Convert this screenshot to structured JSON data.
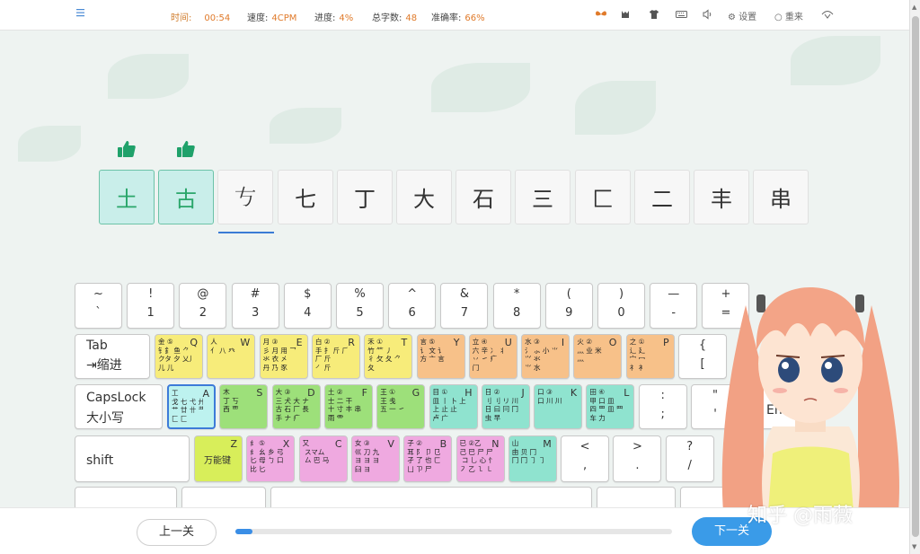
{
  "topbar": {
    "menu_icon": "hamburger-menu-icon",
    "stats": [
      {
        "label": "时间:",
        "value": "00:54"
      },
      {
        "label": "速度:",
        "value": "4CPM"
      },
      {
        "label": "进度:",
        "value": "4%"
      },
      {
        "label": "总字数:",
        "value": "48"
      },
      {
        "label": "准确率:",
        "value": "66%"
      }
    ],
    "settings_label": "设置",
    "restart_label": "重来"
  },
  "characters": [
    "土",
    "古",
    "𠀁",
    "七",
    "丁",
    "大",
    "石",
    "三",
    "匚",
    "二",
    "丰",
    "串"
  ],
  "completed_count": 2,
  "keyboard": {
    "number_row": [
      {
        "top": "~",
        "bottom": "`"
      },
      {
        "top": "!",
        "bottom": "1"
      },
      {
        "top": "@",
        "bottom": "2"
      },
      {
        "top": "#",
        "bottom": "3"
      },
      {
        "top": "$",
        "bottom": "4"
      },
      {
        "top": "%",
        "bottom": "5"
      },
      {
        "top": "^",
        "bottom": "6"
      },
      {
        "top": "&",
        "bottom": "7"
      },
      {
        "top": "*",
        "bottom": "8"
      },
      {
        "top": "(",
        "bottom": "9"
      },
      {
        "top": ")",
        "bottom": "0"
      },
      {
        "top": "—",
        "bottom": "-"
      },
      {
        "top": "+",
        "bottom": "="
      }
    ],
    "tab": {
      "line1": "Tab",
      "line2": "⇥缩进"
    },
    "capslock": {
      "line1": "CapsLock",
      "line2": "大小写"
    },
    "shift": "shift",
    "q_row": [
      {
        "letter": "Q",
        "roots": "金 ⑤\n钅釒 鱼 ⺈\nクタ 夕 乂儿\n儿 儿",
        "color": "yellow"
      },
      {
        "letter": "W",
        "roots": "人\n亻 八 癶\n",
        "color": "yellow"
      },
      {
        "letter": "E",
        "roots": "月 ③\n彡 月 用 乛 豕\n氺 衣 㐅\n丹 乃 豕",
        "color": "yellow"
      },
      {
        "letter": "R",
        "roots": "白 ②\n手 扌 斤 ⺁\n厂 斤\n㇒ 斤",
        "color": "yellow"
      },
      {
        "letter": "T",
        "roots": "禾 ①\n竹 ⺮ 丿\n彳 攵 夂 ⺈\n夂",
        "color": "yellow"
      },
      {
        "letter": "Y",
        "roots": "言 ⑤\n讠 文 讠\n方 亠 言",
        "color": "orange"
      },
      {
        "letter": "U",
        "roots": "立 ④\n六 辛 冫 丬\n丷 ㇀ 疒\n门",
        "color": "orange"
      },
      {
        "letter": "I",
        "roots": "水 ③\n氵 ⺗ 小 ⺌\n⺍ 氺\n⺌ 水",
        "color": "orange"
      },
      {
        "letter": "O",
        "roots": "火 ②\n⺣ 业 米\n灬",
        "color": "orange"
      },
      {
        "letter": "P",
        "roots": "之 ①\n辶 廴\n宀 冖\n礻 衤",
        "color": "orange"
      },
      {
        "top": "{",
        "bottom": "["
      }
    ],
    "a_row": [
      {
        "letter": "A",
        "roots": "工\n戈 七 弋 廾\n艹 廿 卄 龷\n匚 匚",
        "color": "active"
      },
      {
        "letter": "S",
        "roots": "木\n丁 丂\n西 覀\n",
        "color": "green"
      },
      {
        "letter": "D",
        "roots": "大 ③\n三 犬 大 ナ 尢\n古 石 厂 長\n手 ナ 疒",
        "color": "green"
      },
      {
        "letter": "F",
        "roots": "土 ②\n士 二 干\n十 寸 丰 串\n雨 ⻗",
        "color": "green"
      },
      {
        "letter": "G",
        "roots": "王 ①\n王 戋\n五 一 ㇀",
        "color": "green"
      },
      {
        "letter": "H",
        "roots": "目 ①\n皿 丨 卜 上\n上 止 止\n卢 广",
        "color": "cyan"
      },
      {
        "letter": "J",
        "roots": "日 ②\n刂 刂 リ 川\n日 曰 冃 冂\n虫 早",
        "color": "cyan"
      },
      {
        "letter": "K",
        "roots": "口 ③\n口 川 川\n",
        "color": "cyan"
      },
      {
        "letter": "L",
        "roots": "田 ④\n甲 口 皿\n四 罒 皿 ⺲\n车 力",
        "color": "cyan"
      },
      {
        "top": ":",
        "bottom": ";"
      },
      {
        "top": "\"",
        "bottom": "'"
      }
    ],
    "z_row": [
      {
        "letter": "Z",
        "label": "万能键",
        "color": "lime"
      },
      {
        "letter": "X",
        "roots": "纟 ⑤\n纟 幺 乡 弓\n匕 母 ㄅ 口 巴\n比 匕",
        "color": "pink"
      },
      {
        "letter": "C",
        "roots": "又\n スマム\n ㄙ 巴 马",
        "color": "pink"
      },
      {
        "letter": "V",
        "roots": "女 ③\n巛 刀 九\nヨ ヨ ヨ\n臼 ヨ",
        "color": "pink"
      },
      {
        "letter": "B",
        "roots": "子 ②\n耳 阝 卩 ⺋\n孑 了 也 ㄈ\n凵 ㄗ 尸",
        "color": "pink"
      },
      {
        "letter": "N",
        "roots": "已 ②乙\n己 巳 尸 尸 羽\n コ 乚 心 ⺖ 尸\n㇇ 乙 ㇅ ㇄",
        "color": "pink"
      },
      {
        "letter": "M",
        "roots": "山\n由 贝 冂\n冂 冂 ㇆ ㇆",
        "color": "cyan"
      },
      {
        "top": "<",
        "bottom": ","
      },
      {
        "top": ">",
        "bottom": "."
      },
      {
        "top": "?",
        "bottom": "/"
      }
    ],
    "enter_label": "Enter"
  },
  "bottom": {
    "prev_label": "上一关",
    "next_label": "下一关",
    "progress_percent": 4
  },
  "watermark": "知乎 @雨薇"
}
